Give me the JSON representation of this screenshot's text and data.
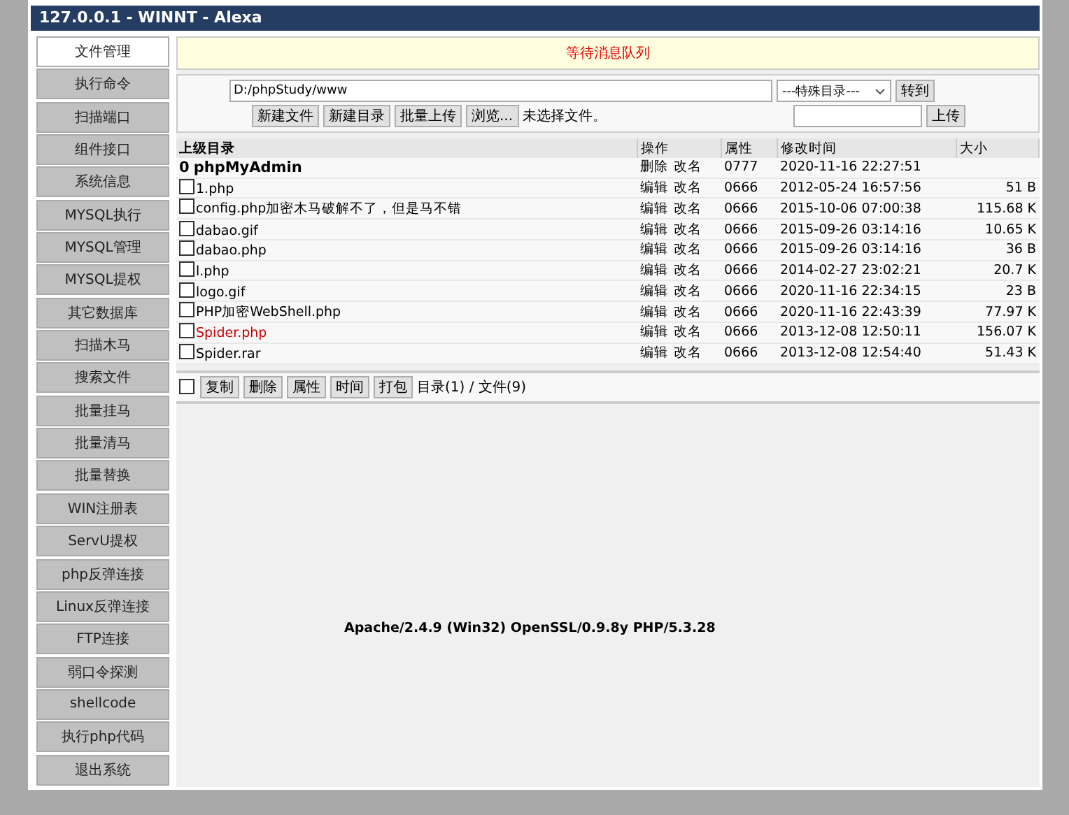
{
  "window": {
    "title": "127.0.0.1 - WINNT - Alexa"
  },
  "sidebar": {
    "items": [
      {
        "label": "文件管理",
        "selected": true
      },
      {
        "label": "执行命令",
        "selected": false
      },
      {
        "label": "扫描端口",
        "selected": false
      },
      {
        "label": "组件接口",
        "selected": false
      },
      {
        "label": "系统信息",
        "selected": false
      },
      {
        "label": "MYSQL执行",
        "selected": false
      },
      {
        "label": "MYSQL管理",
        "selected": false
      },
      {
        "label": "MYSQL提权",
        "selected": false
      },
      {
        "label": "其它数据库",
        "selected": false
      },
      {
        "label": "扫描木马",
        "selected": false
      },
      {
        "label": "搜索文件",
        "selected": false
      },
      {
        "label": "批量挂马",
        "selected": false
      },
      {
        "label": "批量清马",
        "selected": false
      },
      {
        "label": "批量替换",
        "selected": false
      },
      {
        "label": "WIN注册表",
        "selected": false
      },
      {
        "label": "ServU提权",
        "selected": false
      },
      {
        "label": "php反弹连接",
        "selected": false
      },
      {
        "label": "Linux反弹连接",
        "selected": false
      },
      {
        "label": "FTP连接",
        "selected": false
      },
      {
        "label": "弱口令探测",
        "selected": false
      },
      {
        "label": "shellcode",
        "selected": false
      },
      {
        "label": "执行php代码",
        "selected": false
      },
      {
        "label": "退出系统",
        "selected": false
      }
    ]
  },
  "message": "等待消息队列",
  "toolbar": {
    "path": "D:/phpStudy/www",
    "special_dir": "---特殊目录---",
    "go_button": "转到",
    "buttons": [
      "新建文件",
      "新建目录",
      "批量上传"
    ],
    "browse_button": "浏览...",
    "file_status": "未选择文件。",
    "upload_button": "上传"
  },
  "table": {
    "columns": [
      "上级目录",
      "操作",
      "属性",
      "修改时间",
      "大小"
    ],
    "rows": [
      {
        "kind": "dir",
        "icon": "0",
        "name": "phpMyAdmin",
        "actions": [
          "删除",
          "改名"
        ],
        "perm": "0777",
        "modified": "2020-11-16 22:27:51",
        "size": "",
        "flagged": false
      },
      {
        "kind": "file",
        "checked": false,
        "name": "1.php",
        "actions": [
          "编辑",
          "改名"
        ],
        "perm": "0666",
        "modified": "2012-05-24 16:57:56",
        "size": "51 B",
        "flagged": false
      },
      {
        "kind": "file",
        "checked": false,
        "name": "config.php加密木马破解不了，但是马不错",
        "actions": [
          "编辑",
          "改名"
        ],
        "perm": "0666",
        "modified": "2015-10-06 07:00:38",
        "size": "115.68 K",
        "flagged": false
      },
      {
        "kind": "file",
        "checked": false,
        "name": "dabao.gif",
        "actions": [
          "编辑",
          "改名"
        ],
        "perm": "0666",
        "modified": "2015-09-26 03:14:16",
        "size": "10.65 K",
        "flagged": false
      },
      {
        "kind": "file",
        "checked": false,
        "name": "dabao.php",
        "actions": [
          "编辑",
          "改名"
        ],
        "perm": "0666",
        "modified": "2015-09-26 03:14:16",
        "size": "36 B",
        "flagged": false
      },
      {
        "kind": "file",
        "checked": false,
        "name": "l.php",
        "actions": [
          "编辑",
          "改名"
        ],
        "perm": "0666",
        "modified": "2014-02-27 23:02:21",
        "size": "20.7 K",
        "flagged": false
      },
      {
        "kind": "file",
        "checked": false,
        "name": "logo.gif",
        "actions": [
          "编辑",
          "改名"
        ],
        "perm": "0666",
        "modified": "2020-11-16 22:34:15",
        "size": "23 B",
        "flagged": false
      },
      {
        "kind": "file",
        "checked": false,
        "name": "PHP加密WebShell.php",
        "actions": [
          "编辑",
          "改名"
        ],
        "perm": "0666",
        "modified": "2020-11-16 22:43:39",
        "size": "77.97 K",
        "flagged": false
      },
      {
        "kind": "file",
        "checked": false,
        "name": "Spider.php",
        "actions": [
          "编辑",
          "改名"
        ],
        "perm": "0666",
        "modified": "2013-12-08 12:50:11",
        "size": "156.07 K",
        "flagged": true
      },
      {
        "kind": "file",
        "checked": false,
        "name": "Spider.rar",
        "actions": [
          "编辑",
          "改名"
        ],
        "perm": "0666",
        "modified": "2013-12-08 12:54:40",
        "size": "51.43 K",
        "flagged": false
      }
    ]
  },
  "footer": {
    "select_all": false,
    "buttons": [
      "复制",
      "删除",
      "属性",
      "时间",
      "打包"
    ],
    "summary": "目录(1) / 文件(9)"
  },
  "server_info": "Apache/2.4.9 (Win32) OpenSSL/0.9.8y PHP/5.3.28"
}
